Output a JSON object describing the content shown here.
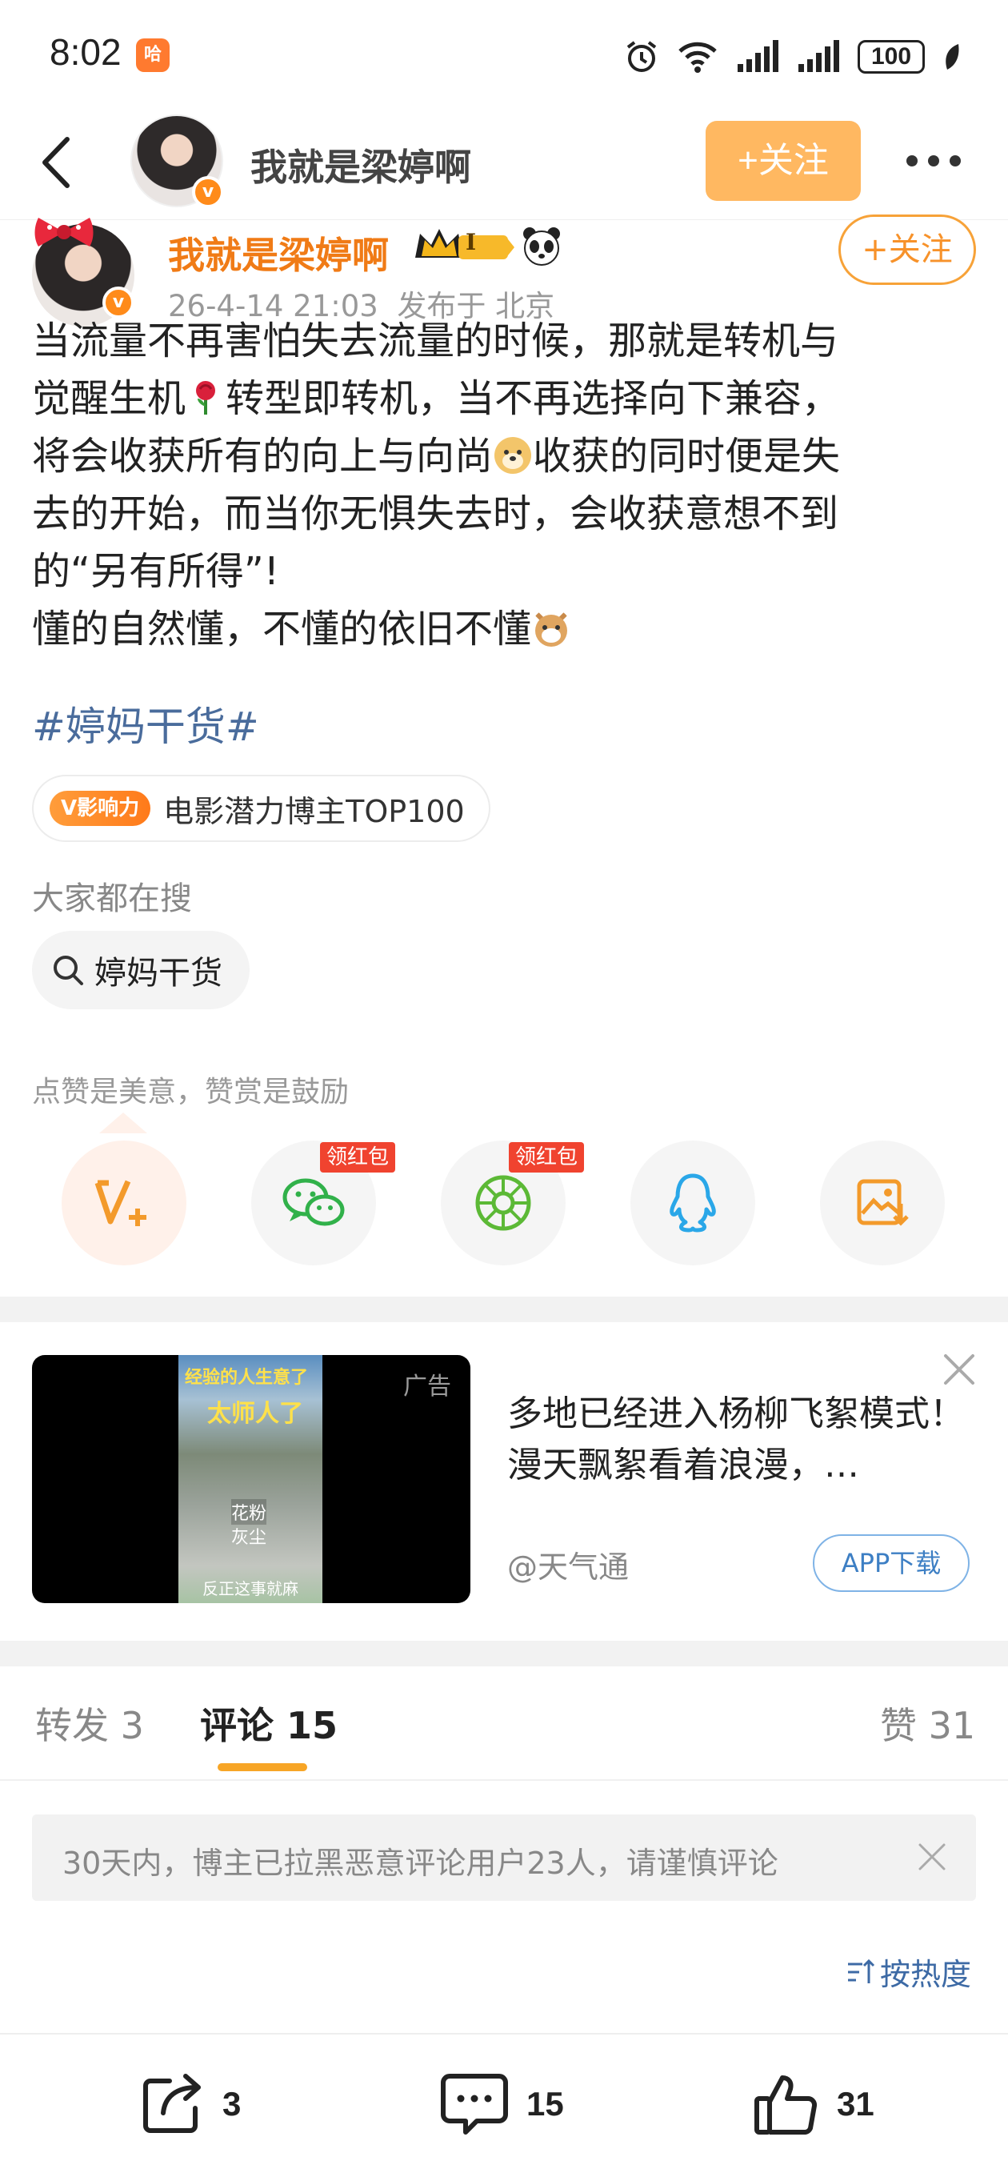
{
  "status_bar": {
    "time": "8:02",
    "app_icon_text": "哈",
    "battery": "100"
  },
  "nav": {
    "user_name": "我就是梁婷啊",
    "follow_label": "+关注"
  },
  "post": {
    "author": "我就是梁婷啊",
    "level_badge": "I",
    "timestamp": "26-4-14 21:03",
    "location": "发布于 北京",
    "follow_label": "+关注",
    "text_lines": [
      "当流量不再害怕失去流量的时候，那就是转机与",
      "觉醒生机",
      "转型即转机，当不再选择向下兼容，",
      "将会收获所有的向上与向尚",
      "收获的同时便是失",
      "去的开始，而当你无惧失去时，会收获意想不到",
      "的“另有所得”!",
      "懂的自然懂，不懂的依旧不懂"
    ],
    "hashtag": "#婷妈干货#",
    "influence_badge": "V影响力",
    "influence_text": "电影潜力博主TOP100",
    "search_title": "大家都在搜",
    "search_chip": "婷妈干货",
    "reward_hint": "点赞是美意，赞赏是鼓励"
  },
  "share_row": {
    "redbag_label_1": "领红包",
    "redbag_label_2": "领红包"
  },
  "ad": {
    "label": "广告",
    "frame_title": "经验的人生意了",
    "frame_title2": "太师人了",
    "frame_tag1": "花粉",
    "frame_tag2": "灰尘",
    "frame_foot": "反正这事就麻",
    "text": "多地已经进入杨柳飞絮模式！漫天飘絮看着浪漫，…",
    "source": "@天气通",
    "app_button": "APP下载"
  },
  "tabs": [
    {
      "label": "转发 3"
    },
    {
      "label": "评论 15"
    },
    {
      "label": "赞 31"
    }
  ],
  "notice": {
    "text": "30天内，博主已拉黑恶意评论用户23人，请谨慎评论"
  },
  "sort": {
    "label": "按热度"
  },
  "bottom_bar": {
    "repost_count": "3",
    "comment_count": "15",
    "like_count": "31"
  },
  "colors": {
    "accent_orange": "#f7a526",
    "link_blue": "#4a6c9c",
    "author_orange": "#f07b16"
  }
}
